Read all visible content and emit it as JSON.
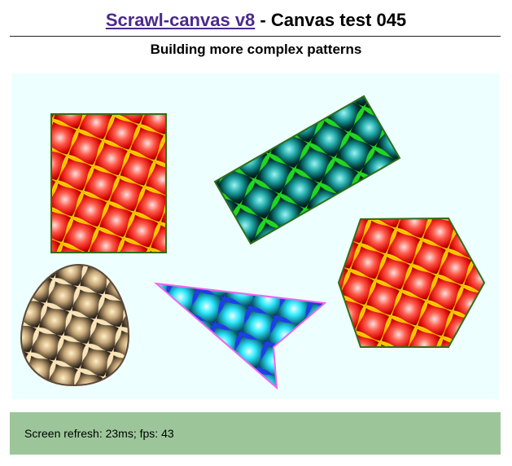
{
  "header": {
    "link_text": "Scrawl-canvas v8",
    "title_rest": " - Canvas test 045",
    "subtitle": "Building more complex patterns",
    "link_color": "#4b2a8c"
  },
  "canvas": {
    "background": "#eeffff",
    "shapes": [
      {
        "name": "red-rectangle",
        "kind": "rect",
        "fill": "red",
        "stroke": "#2f6e1a"
      },
      {
        "name": "teal-rotated-rectangle",
        "kind": "rect-rotated",
        "fill": "teal",
        "stroke": "#2f6e1a"
      },
      {
        "name": "red-hexagon",
        "kind": "polygon",
        "fill": "red",
        "stroke": "#2f6e1a"
      },
      {
        "name": "gold-egg",
        "kind": "egg",
        "fill": "gold",
        "stroke": "#5a4a38"
      },
      {
        "name": "cyan-arrowhead",
        "kind": "polygon",
        "fill": "cyan",
        "stroke": "#ee66ee"
      }
    ]
  },
  "report": {
    "text": "Screen refresh: 23ms; fps: 43",
    "background": "#9cc69a"
  }
}
